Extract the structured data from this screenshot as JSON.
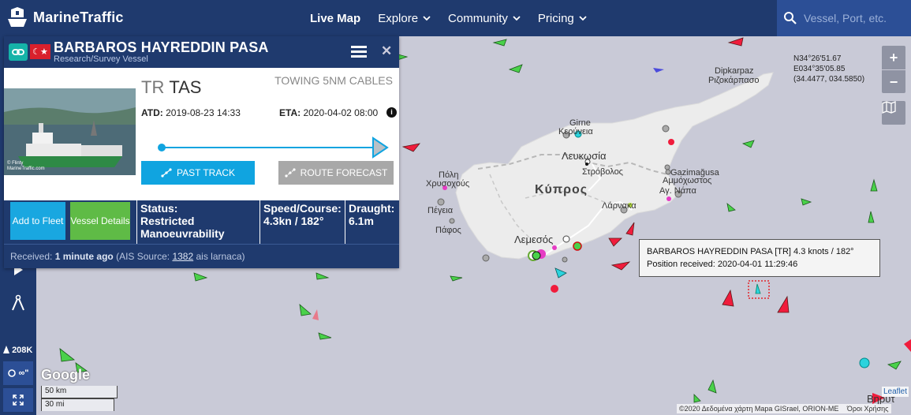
{
  "app": {
    "logo_text": "MarineTraffic",
    "nav": [
      {
        "label": "Live Map",
        "active": true,
        "dropdown": false
      },
      {
        "label": "Explore",
        "active": false,
        "dropdown": true
      },
      {
        "label": "Community",
        "active": false,
        "dropdown": true
      },
      {
        "label": "Pricing",
        "active": false,
        "dropdown": true
      }
    ],
    "search_placeholder": "Vessel, Port, etc."
  },
  "leftbar": {
    "vessel_count": "208K",
    "btn_label": "∞\""
  },
  "vessel": {
    "name": "BARBAROS HAYREDDIN PASA",
    "type": "Research/Survey Vessel",
    "flag": "TR",
    "callsign": "TAS",
    "destination": "TOWING 5NM CABLES",
    "atd_label": "ATD:",
    "atd": "2019-08-23 14:33",
    "eta_label": "ETA:",
    "eta": "2020-04-02 08:00",
    "past_track_label": "PAST TRACK",
    "route_forecast_label": "ROUTE FORECAST",
    "add_to_fleet_label": "Add to Fleet",
    "details_label": "Vessel Details",
    "status_label": "Status:",
    "status_value": "Restricted Manoeuvrability",
    "speed_label": "Speed/Course:",
    "speed_value": "4.3kn / 182°",
    "draught_label": "Draught:",
    "draught_value": "6.1m",
    "received_prefix": "Received:",
    "received_ago": "1 minute ago",
    "received_source_pre": "(AIS Source:",
    "received_source_id": "1382",
    "received_source_post": "ais larnaca)",
    "photo_caption": "© Flinty\nMarineTraffic.com"
  },
  "map": {
    "coords_line1": "N34°26'51.67",
    "coords_line2": "E034°35'05.85",
    "coords_line3": "(34.4477, 034.5850)",
    "places": {
      "dipkarpaz": "Dipkarpaz",
      "rizokarpaso": "Ριζοκάρπασο",
      "girne": "Girne",
      "keryneia": "Κερύνεια",
      "lefkosia": "Λευκωσία",
      "strovolos": "Στρόβολος",
      "kypros": "Κύπρος",
      "polis": "Πόλη",
      "chrysochous": "Χρυσοχούς",
      "pegeia": "Πέγεια",
      "pafos": "Πάφος",
      "gazimagusa": "Gazimağusa",
      "ammochostos": "Αμμόχωστος",
      "agnapa": "Αγ. Νάπα",
      "larnaka": "Λάρνακα",
      "lemesos": "Λεμεσός",
      "beirut_partial": "Βηρυτ"
    },
    "tooltip_line1": "BARBAROS HAYREDDIN PASA [TR] 4.3 knots / 182°",
    "tooltip_line2": "Position received: 2020-04-01 11:29:46",
    "google_label": "Google",
    "scale_km": "50 km",
    "scale_mi": "30 mi",
    "attribution": "©2020 Δεδομένα χάρτη Mapa GISrael, ORION-ME",
    "attribution_tail": "Όροι Χρήσης",
    "leaflet": "Leaflet",
    "zoom_in": "+",
    "zoom_out": "−"
  },
  "colors": {
    "navy": "#1f3a6e",
    "search_bg": "#2c4f96",
    "teal": "#15b3a8",
    "blue_btn": "#10a4e0",
    "green_btn": "#5fbb46",
    "land": "#ececec",
    "sea": "#c9cad7",
    "flag_red": "#d9202c"
  }
}
